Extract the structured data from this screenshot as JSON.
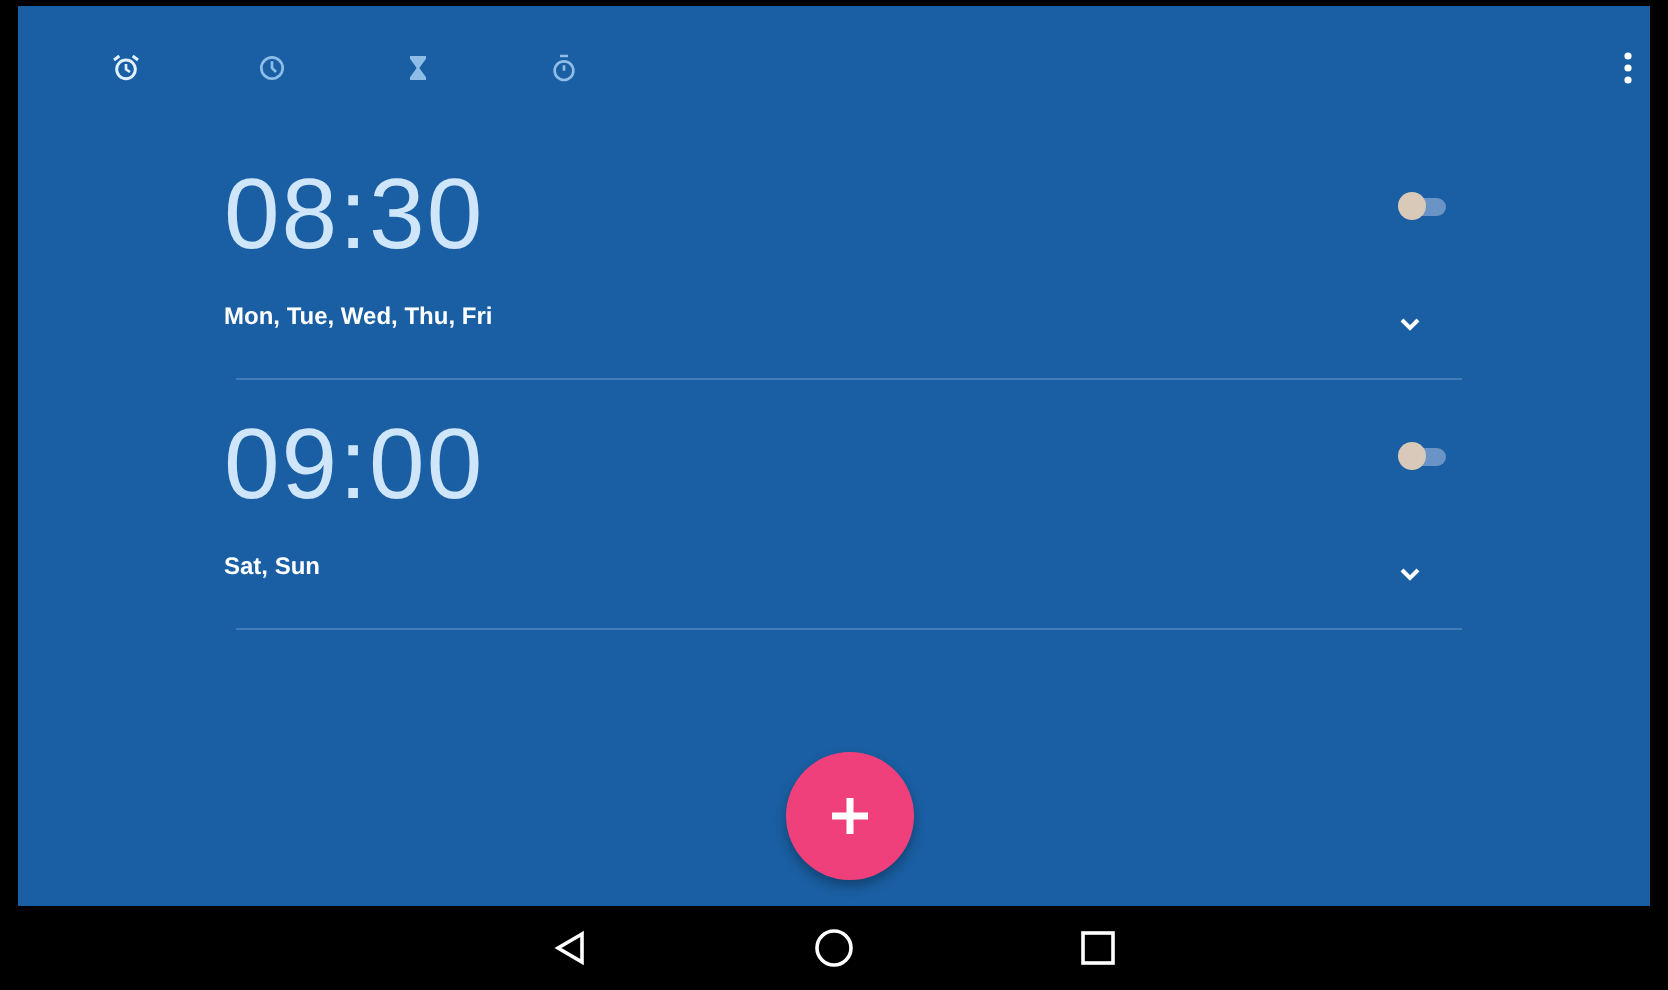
{
  "tabs": [
    {
      "kind": "alarm",
      "selected": true
    },
    {
      "kind": "clock",
      "selected": false
    },
    {
      "kind": "timer",
      "selected": false
    },
    {
      "kind": "stopwatch",
      "selected": false
    }
  ],
  "alarms": [
    {
      "time": "08:30",
      "days": "Mon, Tue, Wed, Thu, Fri",
      "on": false
    },
    {
      "time": "09:00",
      "days": "Sat, Sun",
      "on": false
    }
  ]
}
